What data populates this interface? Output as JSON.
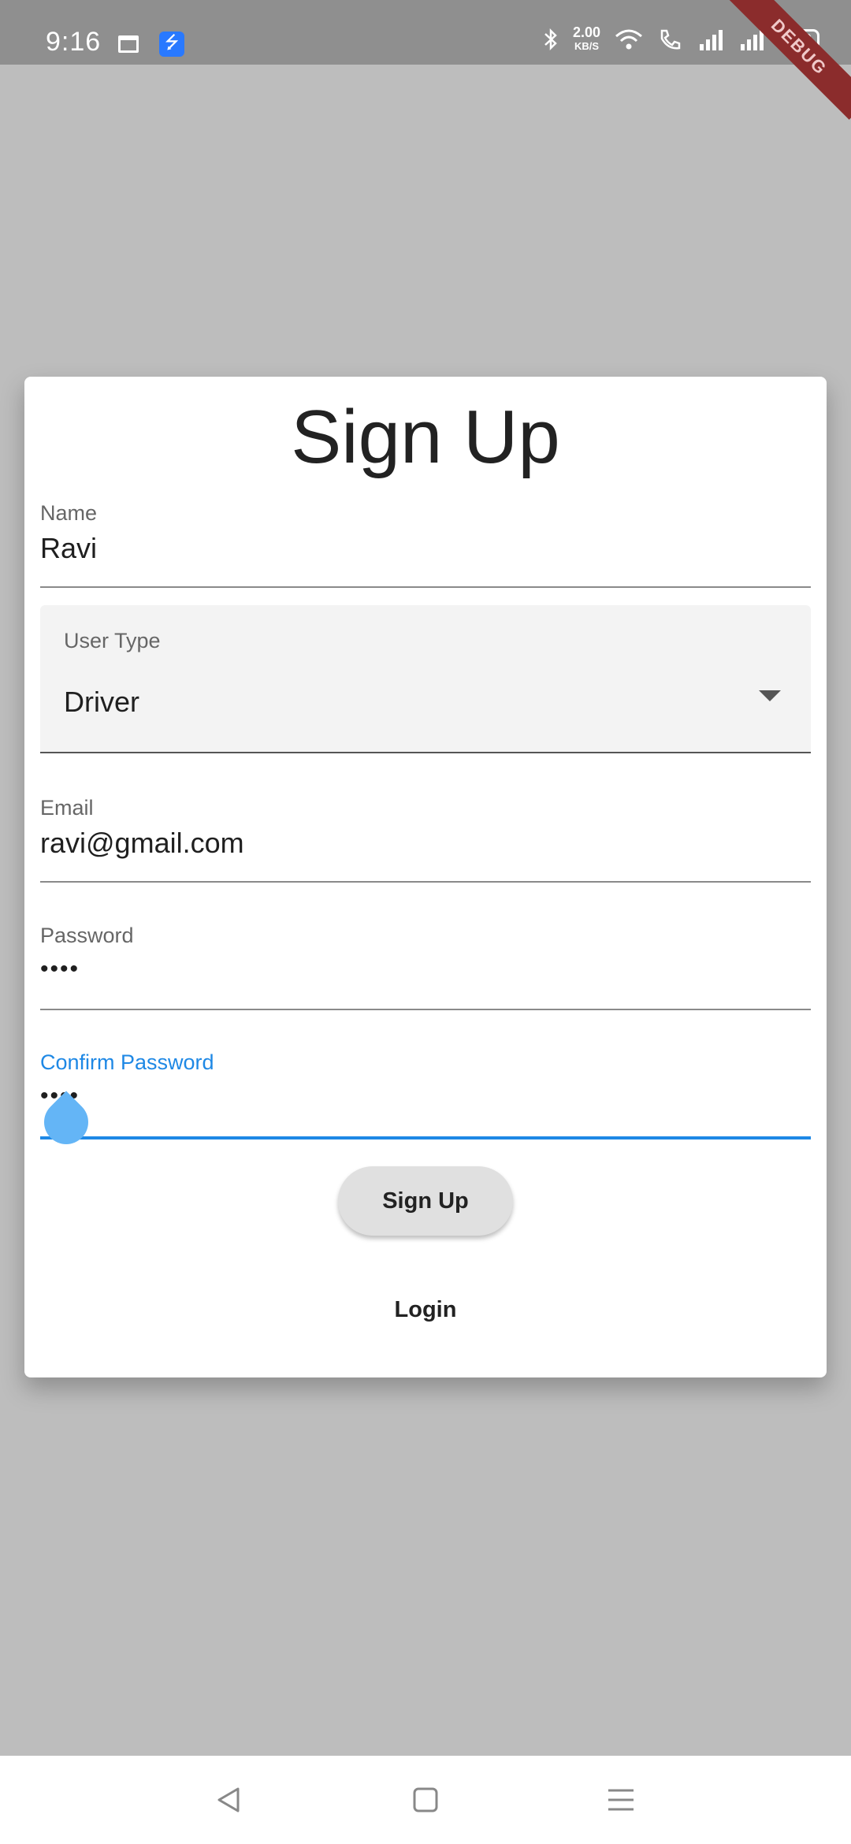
{
  "status_bar": {
    "time": "9:16",
    "net_speed_value": "2.00",
    "net_speed_unit": "KB/S",
    "battery": "100",
    "debug_label": "DEBUG"
  },
  "form": {
    "title": "Sign Up",
    "name": {
      "label": "Name",
      "value": "Ravi"
    },
    "user_type": {
      "label": "User Type",
      "value": "Driver"
    },
    "email": {
      "label": "Email",
      "value": "ravi@gmail.com"
    },
    "password": {
      "label": "Password",
      "value": "••••"
    },
    "confirm_password": {
      "label": "Confirm Password",
      "value": "••••"
    },
    "signup_button": "Sign Up",
    "login_link": "Login"
  },
  "colors": {
    "accent": "#1e88e5",
    "background": "#bdbdbd",
    "status_bar": "#8f8f8f"
  },
  "icons": [
    "calendar-icon",
    "usb-icon",
    "bluetooth-icon",
    "wifi-icon",
    "call-icon",
    "signal-icon",
    "battery-icon",
    "back-icon",
    "home-icon",
    "menu-icon"
  ]
}
